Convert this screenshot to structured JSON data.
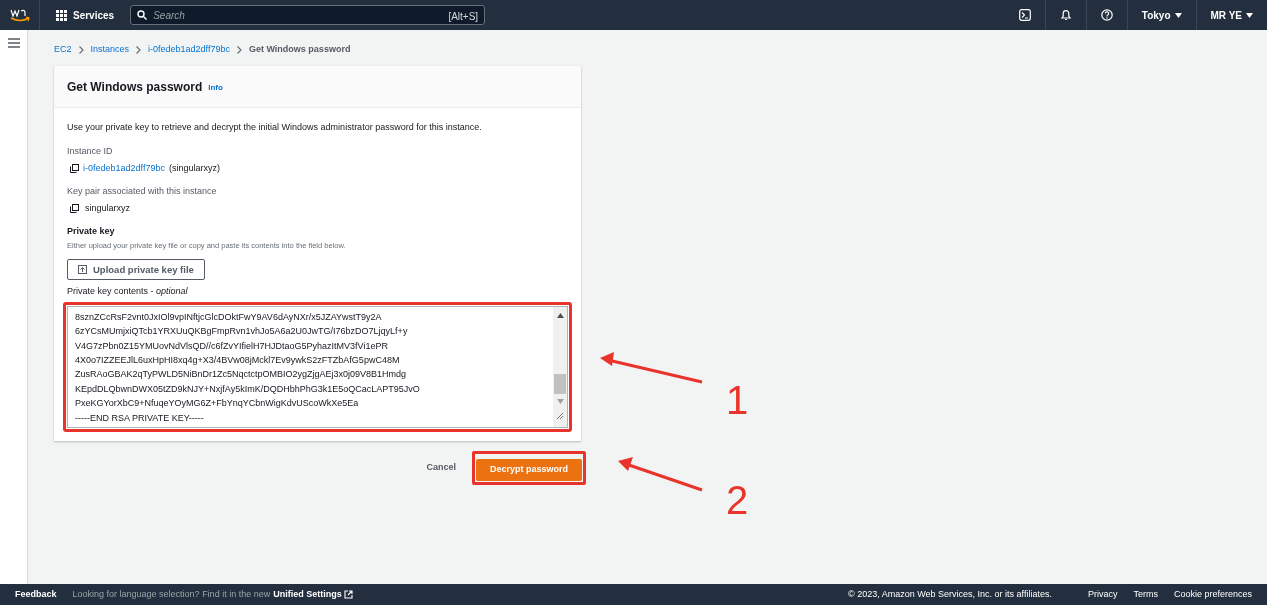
{
  "top_nav": {
    "services": "Services",
    "search": {
      "placeholder": "Search",
      "shortcut": "[Alt+S]"
    },
    "region": "Tokyo",
    "account": "MR YE"
  },
  "breadcrumbs": [
    {
      "label": "EC2",
      "link": true
    },
    {
      "label": "Instances",
      "link": true
    },
    {
      "label": "i-0fedeb1ad2dff79bc",
      "link": true
    },
    {
      "label": "Get Windows password",
      "link": false
    }
  ],
  "panel": {
    "title": "Get Windows password",
    "info": "Info",
    "description": "Use your private key to retrieve and decrypt the initial Windows administrator password for this instance.",
    "instance_id": {
      "label": "Instance ID",
      "value": "i-0fedeb1ad2dff79bc",
      "suffix": "(singularxyz)"
    },
    "key_pair": {
      "label": "Key pair associated with this instance",
      "value": "singularxyz"
    },
    "private_key": {
      "label": "Private key",
      "hint": "Either upload your private key file or copy and paste its contents into the field below.",
      "upload_button": "Upload private key file"
    },
    "contents": {
      "label": "Private key contents - ",
      "optional": "optional",
      "lines": [
        "8sznZCcRsF2vnt0JxIOl9vpINftjcGlcDOktFwY9AV6dAyNXr/x5JZAYwstT9y2A",
        "6zYCsMUmjxiQTcb1YRXUuQKBgFmpRvn1vhJo5A6a2U0JwTG/I76bzDO7LjqyLf+y",
        "V4G7zPbn0Z15YMUovNdVlsQD//c6fZvYIfielH7HJDtaoG5PyhazItMV3fVi1ePR",
        "4X0o7IZZEEJlL6uxHpHI8xq4g+X3/4BVw08jMckl7Ev9ywkS2zFTZbAfG5pwC48M",
        "ZusRAoGBAK2qTyPWLD5NiBnDr1Zc5NqctctpOMBIO2ygZjgAEj3x0j09V8B1Hmdg",
        "KEpdDLQbwnDWX05tZD9kNJY+NxjfAy5kImK/DQDHbhPhG3k1E5oQCacLAPT95JvO",
        "PxeKGYorXbC9+NfuqeYOyMG6Z+FbYnqYCbnWigKdvUScoWkXe5Ea",
        "-----END RSA PRIVATE KEY-----"
      ]
    }
  },
  "actions": {
    "cancel": "Cancel",
    "decrypt": "Decrypt password"
  },
  "annotations": [
    {
      "label": "1"
    },
    {
      "label": "2"
    }
  ],
  "footer": {
    "feedback": "Feedback",
    "language_note": "Looking for language selection? Find it in the new ",
    "unified_settings": "Unified Settings",
    "copyright": "© 2023, Amazon Web Services, Inc. or its affiliates.",
    "links": [
      "Privacy",
      "Terms",
      "Cookie preferences"
    ]
  }
}
